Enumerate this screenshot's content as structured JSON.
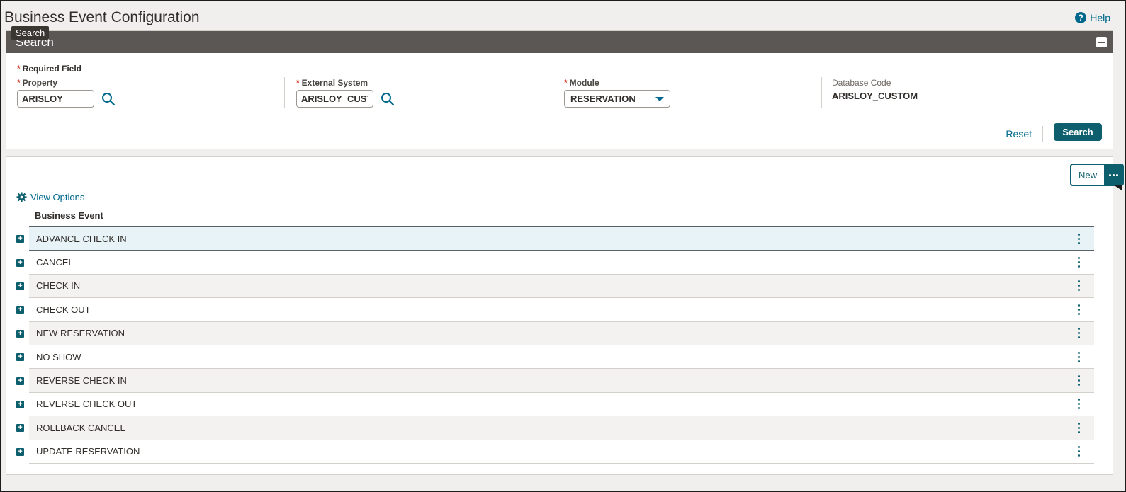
{
  "page": {
    "title": "Business Event Configuration",
    "help_label": "Help"
  },
  "tooltip": "Search",
  "search": {
    "header": "Search",
    "required_note": "Required Field",
    "property": {
      "label": "Property",
      "value": "ARISLOY"
    },
    "external_system": {
      "label": "External System",
      "value": "ARISLOY_CUST"
    },
    "module": {
      "label": "Module",
      "value": "RESERVATION"
    },
    "database_code": {
      "label": "Database Code",
      "value": "ARISLOY_CUSTOM"
    },
    "reset_label": "Reset",
    "search_label": "Search"
  },
  "results": {
    "new_label": "New",
    "view_options_label": "View Options",
    "column_header": "Business Event",
    "rows": [
      "ADVANCE CHECK IN",
      "CANCEL",
      "CHECK IN",
      "CHECK OUT",
      "NEW RESERVATION",
      "NO SHOW",
      "REVERSE CHECK IN",
      "REVERSE CHECK OUT",
      "ROLLBACK CANCEL",
      "UPDATE RESERVATION"
    ],
    "selected_row": 0
  },
  "colors": {
    "accent": "#00688c",
    "button": "#0d5f6d",
    "header": "#5a5754",
    "required": "#d63b25"
  },
  "icons": [
    "help-icon",
    "search-icon",
    "chevron-down-icon",
    "gear-icon",
    "expand-icon",
    "more-icon",
    "collapse-icon"
  ]
}
